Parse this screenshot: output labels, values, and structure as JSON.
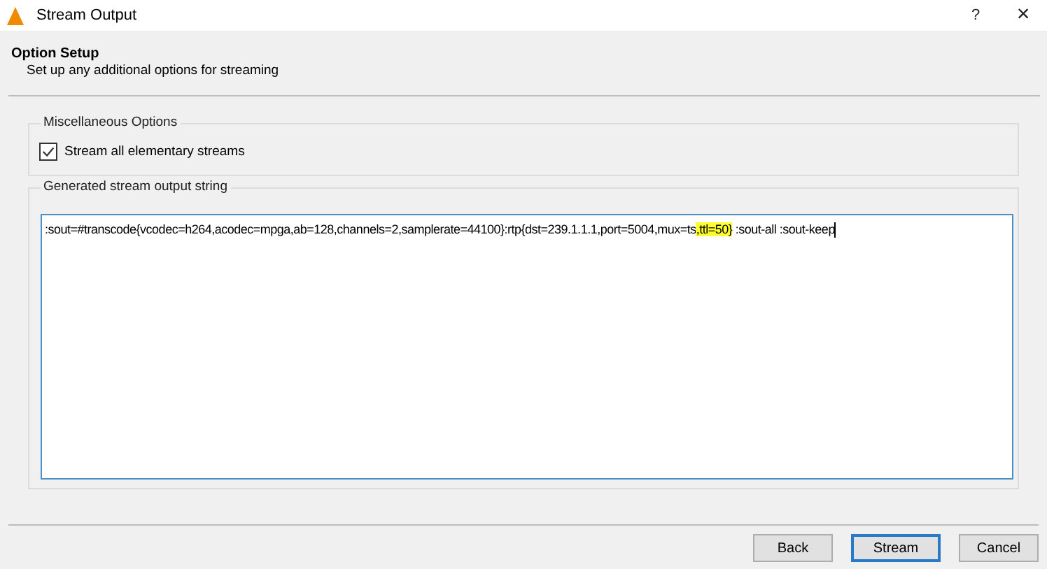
{
  "window": {
    "title": "Stream Output",
    "help": "?",
    "close": "×"
  },
  "header": {
    "title": "Option Setup",
    "subtitle": "Set up any additional options for streaming"
  },
  "misc_group": {
    "title": "Miscellaneous Options",
    "checkbox": {
      "label": "Stream all elementary streams",
      "checked": true
    }
  },
  "output_group": {
    "title": "Generated stream output string",
    "segments": [
      {
        "text": ":sout=#transcode{vcodec=h264,acodec=mpga,ab=128,channels=2,samplerate=44100}:rtp{dst=239.1.1.1,port=5004,mux=ts",
        "highlighted": false
      },
      {
        "text": ",ttl=50}",
        "highlighted": true
      },
      {
        "text": " :sout-all :sout-keep",
        "highlighted": false
      }
    ]
  },
  "buttons": [
    {
      "label": "Back",
      "selected": false
    },
    {
      "label": "Stream",
      "selected": true
    },
    {
      "label": "Cancel",
      "selected": false
    }
  ]
}
